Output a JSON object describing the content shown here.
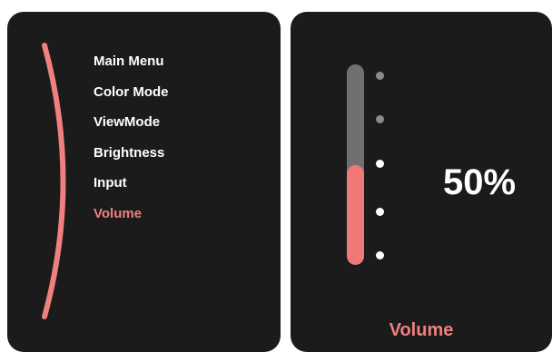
{
  "menu": {
    "items": [
      {
        "label": "Main Menu",
        "active": false
      },
      {
        "label": "Color Mode",
        "active": false
      },
      {
        "label": "ViewMode",
        "active": false
      },
      {
        "label": "Brightness",
        "active": false
      },
      {
        "label": "Input",
        "active": false
      },
      {
        "label": "Volume",
        "active": true
      }
    ]
  },
  "volume": {
    "value_label": "50%",
    "level": 0.5,
    "title": "Volume",
    "ticks": 5
  },
  "colors": {
    "accent": "#f08080",
    "panel_background": "#1b1b1b",
    "track": "#707070",
    "text": "#ffffff"
  }
}
